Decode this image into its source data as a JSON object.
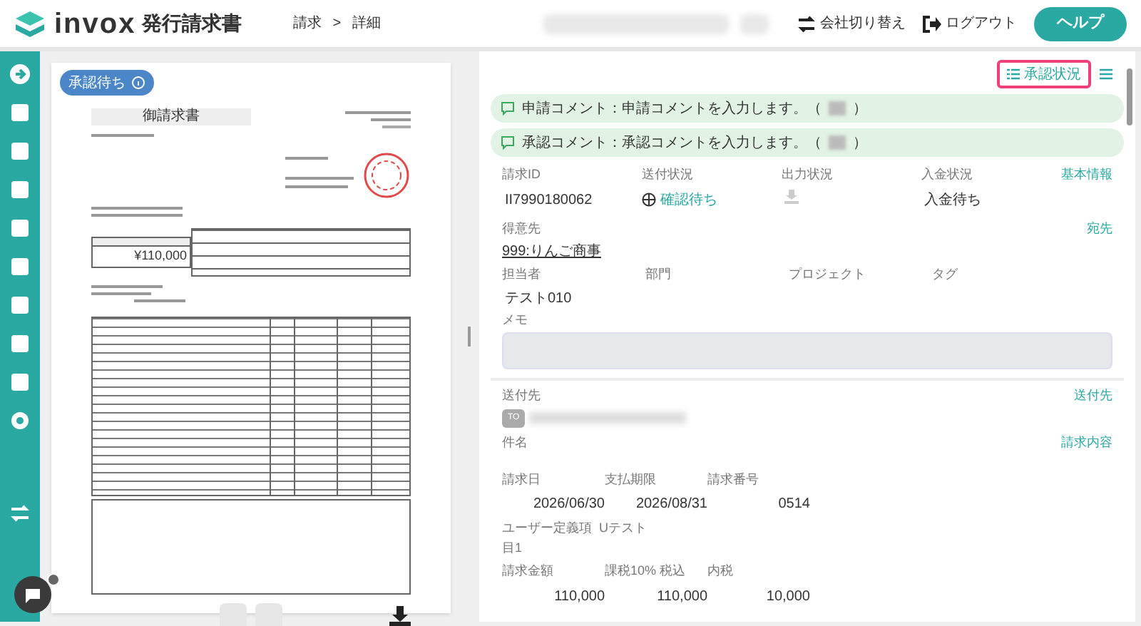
{
  "header": {
    "logo": "invox",
    "product": "発行請求書",
    "breadcrumb": [
      "請求",
      "詳細"
    ],
    "separator": ">",
    "actions": [
      "会社切り替え",
      "ログアウト"
    ],
    "help": "ヘルプ"
  },
  "document": {
    "badge": "承認待ち",
    "title": "御請求書",
    "amount": "¥110,000"
  },
  "toolbar": {
    "status_button": "承認状況",
    "highlighted": true
  },
  "comments": [
    {
      "before": "申請コメント：申請コメントを入力します。（",
      "after": "）"
    },
    {
      "before": "承認コメント：承認コメントを入力します。（",
      "after": "）"
    }
  ],
  "basic": {
    "link": "基本情報",
    "fields": [
      {
        "label": "請求ID",
        "value": "II7990180062",
        "kind": "text"
      },
      {
        "label": "送付状況",
        "value": "確認待ち",
        "kind": "status"
      },
      {
        "label": "出力状況",
        "kind": "download"
      },
      {
        "label": "入金状況",
        "value": "入金待ち",
        "kind": "text"
      }
    ]
  },
  "customer": {
    "label": "得意先",
    "value": "999:りんご商事",
    "link": "宛先"
  },
  "people": [
    {
      "label": "担当者",
      "value": "テスト010"
    },
    {
      "label": "部門"
    },
    {
      "label": "プロジェクト"
    },
    {
      "label": "タグ"
    }
  ],
  "memo": {
    "label": "メモ"
  },
  "recipient": {
    "label": "送付先",
    "link": "送付先",
    "tag": "TO"
  },
  "subject": {
    "label": "件名",
    "link": "請求内容"
  },
  "dates": [
    {
      "label": "請求日",
      "value": "2026/06/30"
    },
    {
      "label": "支払期限",
      "value": "2026/08/31"
    },
    {
      "label": "請求番号",
      "value": "0514"
    }
  ],
  "custom": {
    "label": "ユーザー定義項目1",
    "value": "Uテスト"
  },
  "amounts": [
    {
      "label": "請求金額",
      "value": "110,000"
    },
    {
      "label": "課税10% 税込",
      "value": "110,000"
    },
    {
      "label": "内税",
      "value": "10,000"
    }
  ]
}
